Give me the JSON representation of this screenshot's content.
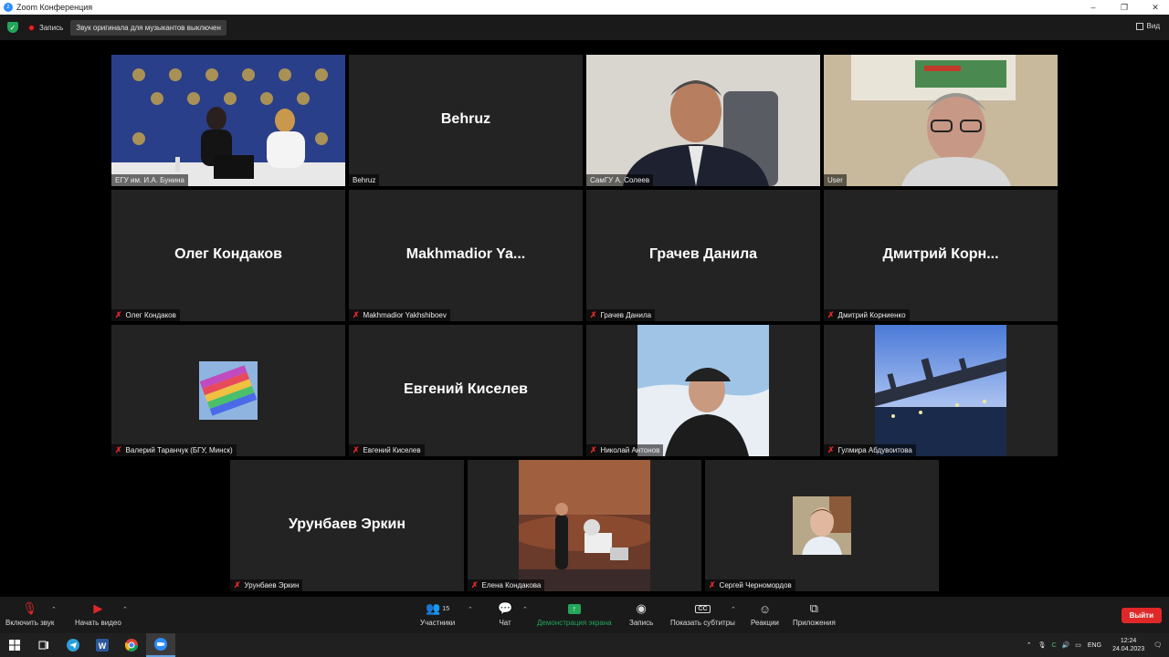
{
  "window": {
    "title": "Zoom Конференция",
    "minimize": "–",
    "maximize": "❐",
    "close": "✕"
  },
  "topbar": {
    "recording_label": "Запись",
    "original_sound": "Звук оригинала для музыкантов выключен",
    "view_label": "Вид"
  },
  "tiles": [
    {
      "label": "ЕГУ им. И.А. Бунина",
      "big": "",
      "muted": false,
      "video": "conference-room"
    },
    {
      "label": "Behruz",
      "big": "Behruz",
      "muted": false,
      "video": ""
    },
    {
      "label": "СамГУ А. Солеев",
      "big": "",
      "muted": false,
      "video": "man-suit"
    },
    {
      "label": "User",
      "big": "",
      "muted": false,
      "video": "man-glasses"
    },
    {
      "label": "Олег Кондаков",
      "big": "Олег Кондаков",
      "muted": true,
      "video": ""
    },
    {
      "label": "Makhmadior Yakhshiboev",
      "big": "Makhmadior  Ya...",
      "muted": true,
      "video": ""
    },
    {
      "label": "Грачев Данила",
      "big": "Грачев Данила",
      "muted": true,
      "video": ""
    },
    {
      "label": "Дмитрий Корниенко",
      "big": "Дмитрий  Корн...",
      "muted": true,
      "video": ""
    },
    {
      "label": "Валерий Таранчук (БГУ, Минск)",
      "big": "",
      "muted": true,
      "video": "avatar-colorful"
    },
    {
      "label": "Евгений Киселев",
      "big": "Евгений Киселев",
      "muted": true,
      "video": ""
    },
    {
      "label": "Николай Антонов",
      "big": "",
      "muted": true,
      "video": "man-cap"
    },
    {
      "label": "Гулмира Абдувоитова",
      "big": "",
      "muted": true,
      "video": "city-night"
    },
    {
      "label": "Урунбаев Эркин",
      "big": "Урунбаев Эркин",
      "muted": true,
      "video": ""
    },
    {
      "label": "Елена Кондакова",
      "big": "",
      "muted": true,
      "video": "mars-scene"
    },
    {
      "label": "Сергей Черноморд­ов",
      "big": "",
      "muted": true,
      "video": "man-portrait"
    }
  ],
  "controls": {
    "audio": "Включить звук",
    "video": "Начать видео",
    "participants": "Участники",
    "participants_count": "15",
    "chat": "Чат",
    "share": "Демонстрация экрана",
    "record": "Запись",
    "captions": "Показать субтитры",
    "reactions": "Реакции",
    "apps": "Приложения",
    "leave": "Выйти",
    "cc_icon": "CC"
  },
  "taskbar": {
    "lang": "ENG",
    "time": "12:24",
    "date": "24.04.2023"
  },
  "colors": {
    "active_speaker": "#e8e84a",
    "share_green": "#23a55a",
    "leave_red": "#e02828"
  }
}
